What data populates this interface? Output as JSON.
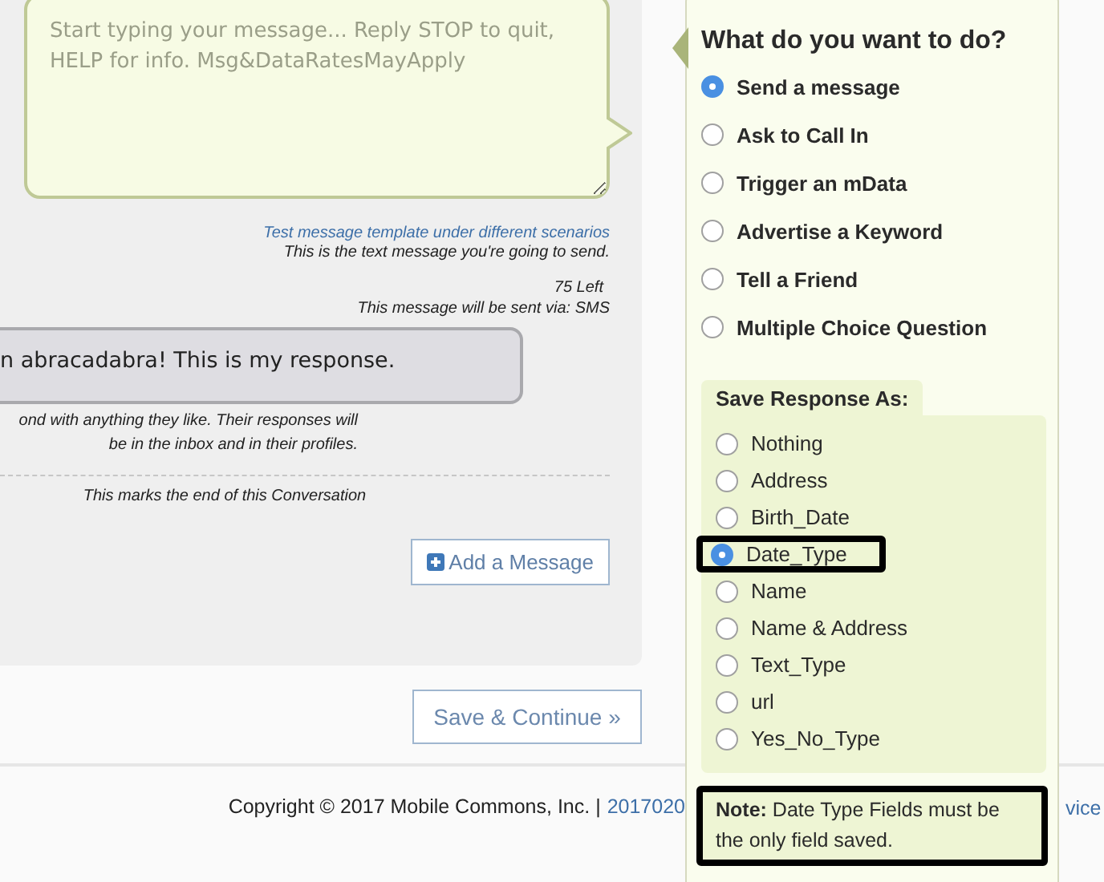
{
  "composer": {
    "placeholder": "Start typing your message... Reply STOP to quit, HELP for info. Msg&DataRatesMayApply",
    "test_link": "Test message template under different scenarios",
    "hint": "This is the text message you're going to send.",
    "count": "75 Left",
    "via": "This message will be sent via: SMS"
  },
  "response": {
    "text": "n abracadabra! This is my response.",
    "note_lines": [
      "ond with anything they like. Their responses will",
      "be in the inbox and in their profiles."
    ]
  },
  "end_note": "This marks the end of this Conversation",
  "add_button": "Add a Message",
  "save_button": "Save & Continue »",
  "footer": {
    "copyright": "Copyright © 2017 Mobile Commons, Inc. |",
    "link": "2017020",
    "tail": "vice"
  },
  "panel": {
    "title": "What do you want to do?",
    "actions": [
      {
        "label": "Send a message",
        "selected": true
      },
      {
        "label": "Ask to Call In",
        "selected": false
      },
      {
        "label": "Trigger an mData",
        "selected": false
      },
      {
        "label": "Advertise a Keyword",
        "selected": false
      },
      {
        "label": "Tell a Friend",
        "selected": false
      },
      {
        "label": "Multiple Choice Question",
        "selected": false
      }
    ],
    "save_as": {
      "label": "Save Response As:",
      "options": [
        {
          "label": "Nothing",
          "selected": false,
          "highlighted": false
        },
        {
          "label": "Address",
          "selected": false,
          "highlighted": false
        },
        {
          "label": "Birth_Date",
          "selected": false,
          "highlighted": false
        },
        {
          "label": "Date_Type",
          "selected": true,
          "highlighted": true
        },
        {
          "label": "Name",
          "selected": false,
          "highlighted": false
        },
        {
          "label": "Name & Address",
          "selected": false,
          "highlighted": false
        },
        {
          "label": "Text_Type",
          "selected": false,
          "highlighted": false
        },
        {
          "label": "url",
          "selected": false,
          "highlighted": false
        },
        {
          "label": "Yes_No_Type",
          "selected": false,
          "highlighted": false
        }
      ],
      "note": {
        "text": "**Note:** Date Type Fields must be the only field saved.",
        "highlighted": true
      }
    }
  }
}
